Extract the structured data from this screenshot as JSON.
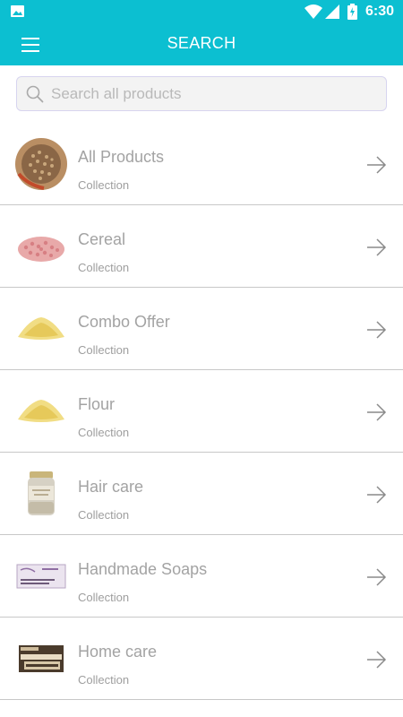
{
  "status_bar": {
    "time": "6:30",
    "icons": [
      "image-icon",
      "wifi-icon",
      "signal-icon",
      "battery-icon"
    ]
  },
  "app_bar": {
    "title": "SEARCH",
    "menu_icon": "hamburger-menu-icon"
  },
  "search": {
    "placeholder": "Search all products",
    "value": ""
  },
  "colors": {
    "accent": "#0cbfd1",
    "text_muted": "#a3a3a3",
    "divider": "#c8c8c8"
  },
  "collections": [
    {
      "name": "All Products",
      "subtitle": "Collection",
      "thumb": "seeds-bowl-image"
    },
    {
      "name": "Cereal",
      "subtitle": "Collection",
      "thumb": "pink-grains-image"
    },
    {
      "name": "Combo Offer",
      "subtitle": "Collection",
      "thumb": "yellow-powder-image"
    },
    {
      "name": "Flour",
      "subtitle": "Collection",
      "thumb": "yellow-powder-image"
    },
    {
      "name": "Hair care",
      "subtitle": "Collection",
      "thumb": "jar-image"
    },
    {
      "name": "Handmade Soaps",
      "subtitle": "Collection",
      "thumb": "soap-bar-image"
    },
    {
      "name": "Home care",
      "subtitle": "Collection",
      "thumb": "dishwash-soap-image"
    }
  ]
}
